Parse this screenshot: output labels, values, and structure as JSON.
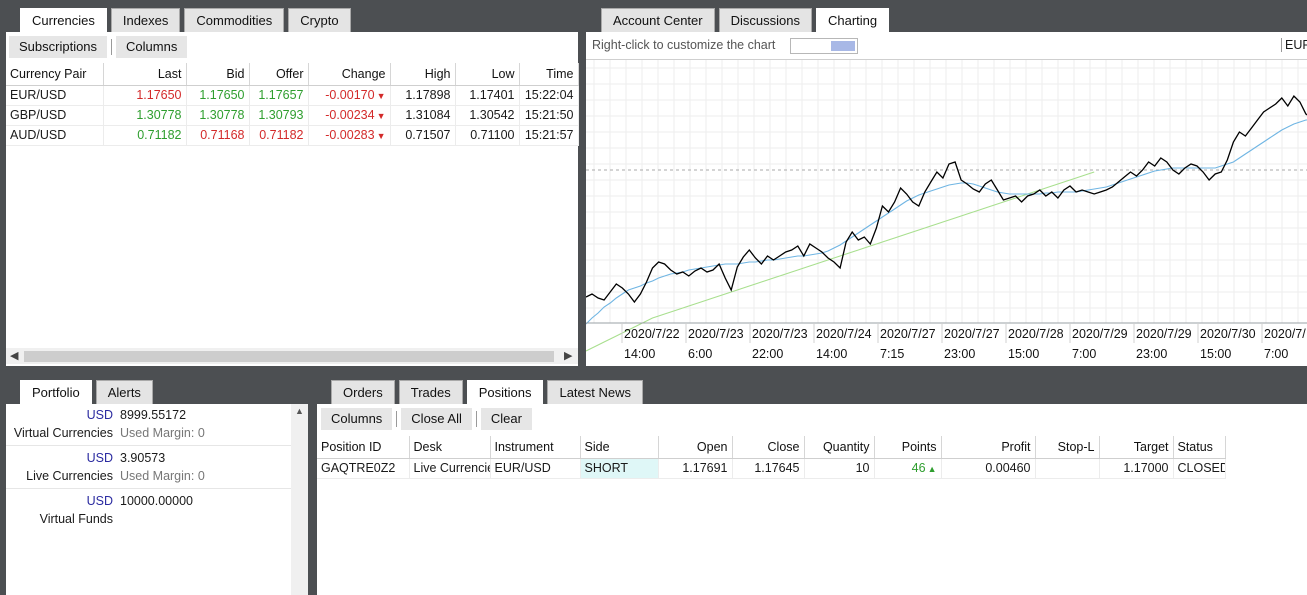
{
  "top_left": {
    "tabs": [
      "Currencies",
      "Indexes",
      "Commodities",
      "Crypto"
    ],
    "toolbar": {
      "subscriptions": "Subscriptions",
      "columns": "Columns"
    },
    "columns": [
      "Currency Pair",
      "Last",
      "Bid",
      "Offer",
      "Change",
      "High",
      "Low",
      "Time"
    ],
    "rows": [
      {
        "pair": "EUR/USD",
        "last": "1.17650",
        "bid": "1.17650",
        "offer": "1.17657",
        "change": "-0.00170",
        "high": "1.17898",
        "low": "1.17401",
        "time": "15:22:04"
      },
      {
        "pair": "GBP/USD",
        "last": "1.30778",
        "bid": "1.30778",
        "offer": "1.30793",
        "change": "-0.00234",
        "high": "1.31084",
        "low": "1.30542",
        "time": "15:21:50"
      },
      {
        "pair": "AUD/USD",
        "last": "0.71182",
        "bid": "0.71168",
        "offer": "0.71182",
        "change": "-0.00283",
        "high": "0.71507",
        "low": "0.71100",
        "time": "15:21:57"
      }
    ]
  },
  "top_right": {
    "tabs": [
      "Account Center",
      "Discussions",
      "Charting"
    ],
    "chart_hint": "Right-click to customize the chart",
    "symbol_label": "EUR",
    "chart_data": {
      "type": "line",
      "x_tick_labels": [
        [
          "2020/7/22",
          "14:00"
        ],
        [
          "2020/7/23",
          "6:00"
        ],
        [
          "2020/7/23",
          "22:00"
        ],
        [
          "2020/7/24",
          "14:00"
        ],
        [
          "2020/7/27",
          "7:15"
        ],
        [
          "2020/7/27",
          "23:00"
        ],
        [
          "2020/7/28",
          "15:00"
        ],
        [
          "2020/7/29",
          "7:00"
        ],
        [
          "2020/7/29",
          "23:00"
        ],
        [
          "2020/7/30",
          "15:00"
        ],
        [
          "2020/7/",
          "7:00"
        ]
      ],
      "grid": true,
      "series": [
        {
          "color": "#000000",
          "values": [
            265,
            262,
            266,
            268,
            260,
            252,
            256,
            262,
            270,
            262,
            250,
            236,
            230,
            232,
            238,
            242,
            240,
            244,
            239,
            236,
            240,
            238,
            232,
            246,
            258,
            235,
            225,
            218,
            226,
            232,
            224,
            228,
            224,
            220,
            218,
            214,
            224,
            212,
            216,
            220,
            226,
            230,
            236,
            210,
            200,
            208,
            205,
            212,
            196,
            174,
            180,
            170,
            156,
            162,
            170,
            174,
            160,
            150,
            140,
            146,
            132,
            130,
            148,
            152,
            157,
            160,
            152,
            148,
            158,
            168,
            166,
            164,
            170,
            164,
            162,
            158,
            164,
            160,
            166,
            158,
            154,
            160,
            158,
            160,
            162,
            160,
            158,
            155,
            150,
            145,
            140,
            144,
            138,
            130,
            134,
            126,
            130,
            138,
            142,
            136,
            132,
            134,
            140,
            148,
            142,
            140,
            128,
            110,
            100,
            104,
            96,
            88,
            80,
            76,
            72,
            66,
            74,
            64,
            70,
            82,
            86
          ]
        },
        {
          "color": "#6fb5e3",
          "values": [
            292,
            286,
            281,
            275,
            271,
            266,
            262,
            258,
            256,
            254,
            251,
            249,
            246,
            244,
            242,
            241,
            240,
            238,
            237,
            236,
            235,
            234,
            233,
            232,
            232,
            232,
            231,
            230,
            230,
            229,
            228,
            228,
            227,
            226,
            225,
            224,
            224,
            223,
            222,
            221,
            219,
            216,
            213,
            209,
            205,
            201,
            197,
            193,
            189,
            185,
            181,
            177,
            173,
            169,
            166,
            163,
            161,
            159,
            157,
            155,
            153,
            152,
            151,
            151,
            152,
            154,
            156,
            158,
            160,
            161,
            162,
            162,
            162,
            162,
            162,
            162,
            161,
            161,
            160,
            160,
            160,
            160,
            159,
            158,
            157,
            156,
            155,
            153,
            151,
            149,
            147,
            145,
            143,
            141,
            139,
            138,
            137,
            136,
            136,
            136,
            136,
            136,
            136,
            136,
            136,
            134,
            132,
            130,
            126,
            122,
            118,
            114,
            110,
            106,
            102,
            98,
            95,
            92,
            90,
            88,
            88
          ]
        },
        {
          "color": "#a8df8e",
          "values": [
            319,
            316,
            313,
            310,
            307,
            304,
            301,
            298,
            295,
            292,
            289,
            286,
            284,
            282,
            280,
            278,
            276,
            274,
            272,
            270,
            268,
            266,
            264,
            262,
            260,
            258,
            256,
            254,
            252,
            250,
            248,
            246,
            244,
            242,
            240,
            238,
            236,
            234,
            232,
            230,
            228,
            226,
            224,
            222,
            220,
            218,
            216,
            214,
            212,
            210,
            208,
            206,
            204,
            202,
            200,
            198,
            196,
            194,
            192,
            190,
            188,
            186,
            184,
            182,
            180,
            178,
            176,
            174,
            172,
            170,
            168,
            166,
            164,
            162,
            160,
            158,
            156,
            154,
            152,
            150,
            148,
            146,
            144,
            142,
            140
          ]
        }
      ],
      "reference_line": 138
    }
  },
  "bottom_left": {
    "tabs": [
      "Portfolio",
      "Alerts"
    ],
    "rows": [
      {
        "currency": "USD",
        "value": "8999.55172",
        "label": "Virtual Currencies",
        "sub_label": "Used Margin:",
        "sub_value": "0"
      },
      {
        "currency": "USD",
        "value": "3.90573",
        "label": "Live Currencies",
        "sub_label": "Used Margin:",
        "sub_value": "0"
      },
      {
        "currency": "USD",
        "value": "10000.00000",
        "label": "Virtual Funds"
      }
    ]
  },
  "bottom_right": {
    "tabs": [
      "Orders",
      "Trades",
      "Positions",
      "Latest News"
    ],
    "toolbar": {
      "columns": "Columns",
      "close_all": "Close All",
      "clear": "Clear"
    },
    "columns": [
      "Position ID",
      "Desk",
      "Instrument",
      "Side",
      "Open",
      "Close",
      "Quantity",
      "Points",
      "Profit",
      "Stop-L",
      "Target",
      "Status"
    ],
    "rows": [
      {
        "id": "GAQTRE0Z2",
        "desk": "Live Currencie",
        "instrument": "EUR/USD",
        "side": "SHORT",
        "open": "1.17691",
        "close": "1.17645",
        "quantity": "10",
        "points": "46",
        "profit": "0.00460",
        "stop": "",
        "target": "1.17000",
        "status": "CLOSED"
      }
    ]
  },
  "colors": {
    "up": "#2f9e2f",
    "down": "#d32a2a",
    "usd": "#2a2aa0",
    "short_bg": "#dff7f7"
  }
}
